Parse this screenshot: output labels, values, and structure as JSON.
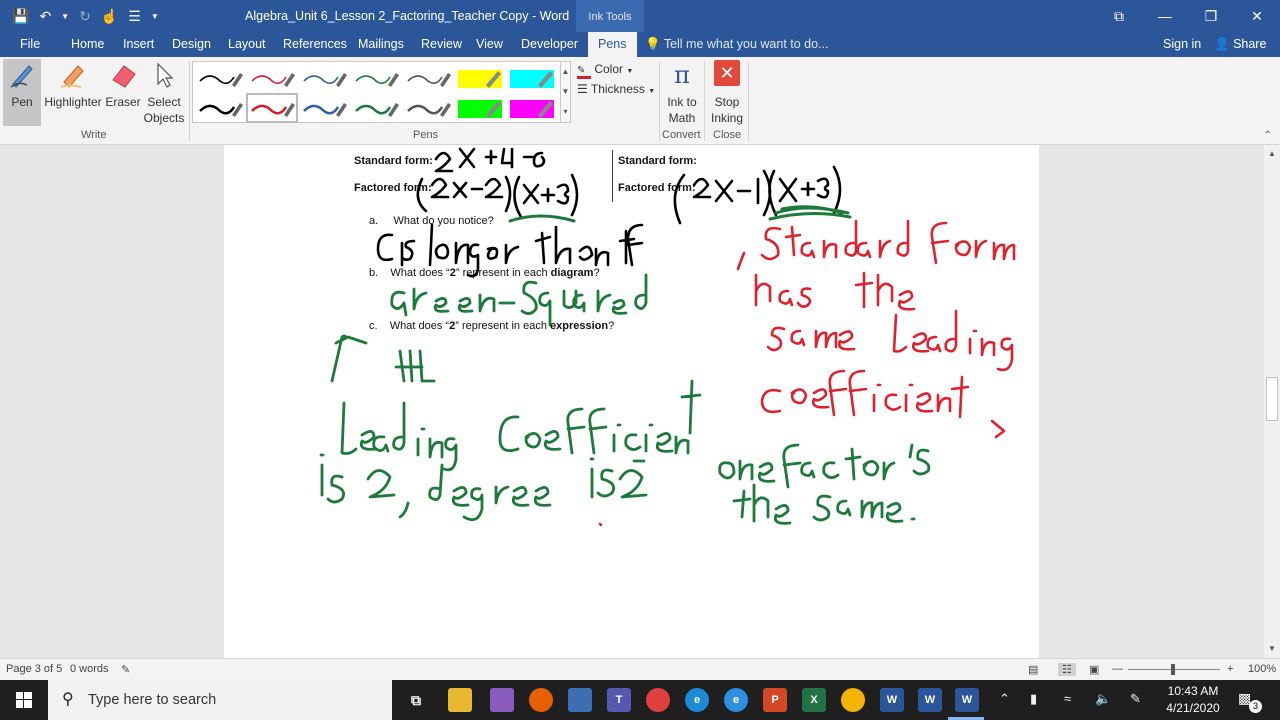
{
  "window": {
    "doc_title": "Algebra_Unit 6_Lesson 2_Factoring_Teacher Copy - Word",
    "ink_tools_label": "Ink Tools"
  },
  "tabs": [
    {
      "label": "File"
    },
    {
      "label": "Home"
    },
    {
      "label": "Insert"
    },
    {
      "label": "Design"
    },
    {
      "label": "Layout"
    },
    {
      "label": "References"
    },
    {
      "label": "Mailings"
    },
    {
      "label": "Review"
    },
    {
      "label": "View"
    },
    {
      "label": "Developer"
    },
    {
      "label": "Pens"
    }
  ],
  "tell_me_placeholder": "Tell me what you want to do...",
  "account": {
    "sign_in": "Sign in",
    "share": "Share"
  },
  "ribbon": {
    "write": {
      "label": "Write",
      "pen": "Pen",
      "highlighter": "Highlighter",
      "eraser": "Eraser",
      "select_line1": "Select",
      "select_line2": "Objects"
    },
    "pens": {
      "label": "Pens",
      "color": "Color",
      "thickness": "Thickness",
      "row1": [
        "#000000",
        "#d81e2c",
        "#2e5fa8",
        "#1d7a3a",
        "#555555",
        "#ffff00",
        "#00ffff"
      ],
      "row2": [
        "#000000",
        "#d81e2c",
        "#2e5fa8",
        "#1d7a3a",
        "#555555",
        "#00ff00",
        "#ff00ff"
      ]
    },
    "convert": {
      "label": "Convert",
      "line1": "Ink to",
      "line2": "Math"
    },
    "close": {
      "label": "Close",
      "line1": "Stop",
      "line2": "Inking"
    }
  },
  "document": {
    "standard_form_label": "Standard form:",
    "factored_form_label": "Factored form:",
    "q_a_letter": "a.",
    "q_a": "What do you notice?",
    "q_b_letter": "b.",
    "q_b_pre": "What does “",
    "q_b_num": "2",
    "q_b_mid": "” represent in each ",
    "q_b_bold": "diagram",
    "q_b_end": "?",
    "q_c_letter": "c.",
    "q_c_pre": "What does “",
    "q_c_num": "2",
    "q_c_mid": "” represent in each ",
    "q_c_bold": "expression",
    "q_c_end": "?"
  },
  "status": {
    "page": "Page 3 of 5",
    "words": "0 words",
    "zoom": "100%"
  },
  "taskbar": {
    "search_placeholder": "Type here to search",
    "time": "10:43 AM",
    "date": "4/21/2020",
    "notifications": "3"
  },
  "colors": {
    "word_blue": "#2b579a",
    "ink_green": "#1d7a3a",
    "ink_red": "#e0202c",
    "ink_black": "#000000"
  }
}
